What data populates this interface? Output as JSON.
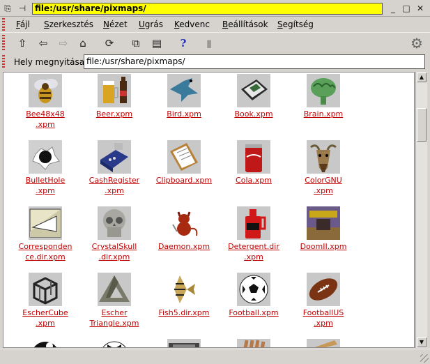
{
  "window": {
    "title": "file:/usr/share/pixmaps/",
    "controls": [
      "minimize-icon",
      "maximize-icon",
      "close-icon"
    ]
  },
  "menu": [
    {
      "label": "Fájl",
      "mnemonic": "F",
      "rest": "ájl"
    },
    {
      "label": "Szerkesztés",
      "mnemonic": "S",
      "rest": "zerkesztés"
    },
    {
      "label": "Nézet",
      "mnemonic": "N",
      "rest": "ézet"
    },
    {
      "label": "Ugrás",
      "mnemonic": "U",
      "rest": "grás"
    },
    {
      "label": "Kedvenc",
      "mnemonic": "K",
      "rest": "edvenc"
    },
    {
      "label": "Beállítások",
      "mnemonic": "B",
      "rest": "eállítások"
    },
    {
      "label": "Segítség",
      "mnemonic": "S",
      "rest": "egítség"
    }
  ],
  "toolbar": {
    "buttons": [
      {
        "name": "up-icon",
        "glyph": "⇧",
        "enabled": true
      },
      {
        "name": "back-icon",
        "glyph": "⇦",
        "enabled": true
      },
      {
        "name": "forward-icon",
        "glyph": "⇨",
        "enabled": false
      },
      {
        "name": "home-icon",
        "glyph": "⌂",
        "enabled": true
      },
      {
        "name": "reload-icon",
        "glyph": "⟳",
        "enabled": true
      },
      {
        "name": "copy-icon",
        "glyph": "⧉",
        "enabled": true
      },
      {
        "name": "paste-icon",
        "glyph": "▤",
        "enabled": true
      },
      {
        "name": "help-icon",
        "glyph": "?",
        "enabled": true
      },
      {
        "name": "stop-icon",
        "glyph": "▮",
        "enabled": false
      }
    ],
    "settings_icon": "gear-icon"
  },
  "location": {
    "label": "Hely megnyitása:",
    "value": "file:/usr/share/pixmaps/"
  },
  "files": [
    {
      "name": "Bee48x48.xpm",
      "line1": "Bee48x48",
      "line2": ".xpm",
      "icon": "bee-icon"
    },
    {
      "name": "Beer.xpm",
      "line1": "Beer.xpm",
      "line2": "",
      "icon": "beer-icon"
    },
    {
      "name": "Bird.xpm",
      "line1": "Bird.xpm",
      "line2": "",
      "icon": "bird-icon"
    },
    {
      "name": "Book.xpm",
      "line1": "Book.xpm",
      "line2": "",
      "icon": "book-icon"
    },
    {
      "name": "Brain.xpm",
      "line1": "Brain.xpm",
      "line2": "",
      "icon": "brain-icon"
    },
    {
      "name": "BulletHole.xpm",
      "line1": "BulletHole",
      "line2": ".xpm",
      "icon": "bullet-hole-icon"
    },
    {
      "name": "CashRegister.xpm",
      "line1": "CashRegister",
      "line2": ".xpm",
      "icon": "cash-register-icon"
    },
    {
      "name": "Clipboard.xpm",
      "line1": "Clipboard.xpm",
      "line2": "",
      "icon": "clipboard-icon"
    },
    {
      "name": "Cola.xpm",
      "line1": "Cola.xpm",
      "line2": "",
      "icon": "cola-icon"
    },
    {
      "name": "ColorGNU.xpm",
      "line1": "ColorGNU",
      "line2": ".xpm",
      "icon": "gnu-icon"
    },
    {
      "name": "Correspondence.dir.xpm",
      "line1": "Corresponden",
      "line2": "ce.dir.xpm",
      "icon": "correspondence-icon"
    },
    {
      "name": "CrystalSkull.dir.xpm",
      "line1": "CrystalSkull",
      "line2": ".dir.xpm",
      "icon": "skull-icon"
    },
    {
      "name": "Daemon.xpm",
      "line1": "Daemon.xpm",
      "line2": "",
      "icon": "daemon-icon"
    },
    {
      "name": "Detergent.dir.xpm",
      "line1": "Detergent.dir",
      "line2": ".xpm",
      "icon": "detergent-icon"
    },
    {
      "name": "DoomII.xpm",
      "line1": "DoomII.xpm",
      "line2": "",
      "icon": "doom-icon"
    },
    {
      "name": "EscherCube.xpm",
      "line1": "EscherCube",
      "line2": ".xpm",
      "icon": "escher-cube-icon"
    },
    {
      "name": "Escher Triangle.xpm",
      "line1": "Escher",
      "line2": "Triangle.xpm",
      "icon": "escher-triangle-icon"
    },
    {
      "name": "Fish5.dir.xpm",
      "line1": "Fish5.dir.xpm",
      "line2": "",
      "icon": "fish-icon"
    },
    {
      "name": "Football.xpm",
      "line1": "Football.xpm",
      "line2": "",
      "icon": "soccer-ball-icon"
    },
    {
      "name": "FootballUS.xpm",
      "line1": "FootballUS",
      "line2": ".xpm",
      "icon": "american-football-icon"
    }
  ],
  "colors": {
    "title_field": "#ffff00",
    "link": "#c00000",
    "help_icon": "#1f2fb0",
    "menu_grip": "#cc3333"
  }
}
